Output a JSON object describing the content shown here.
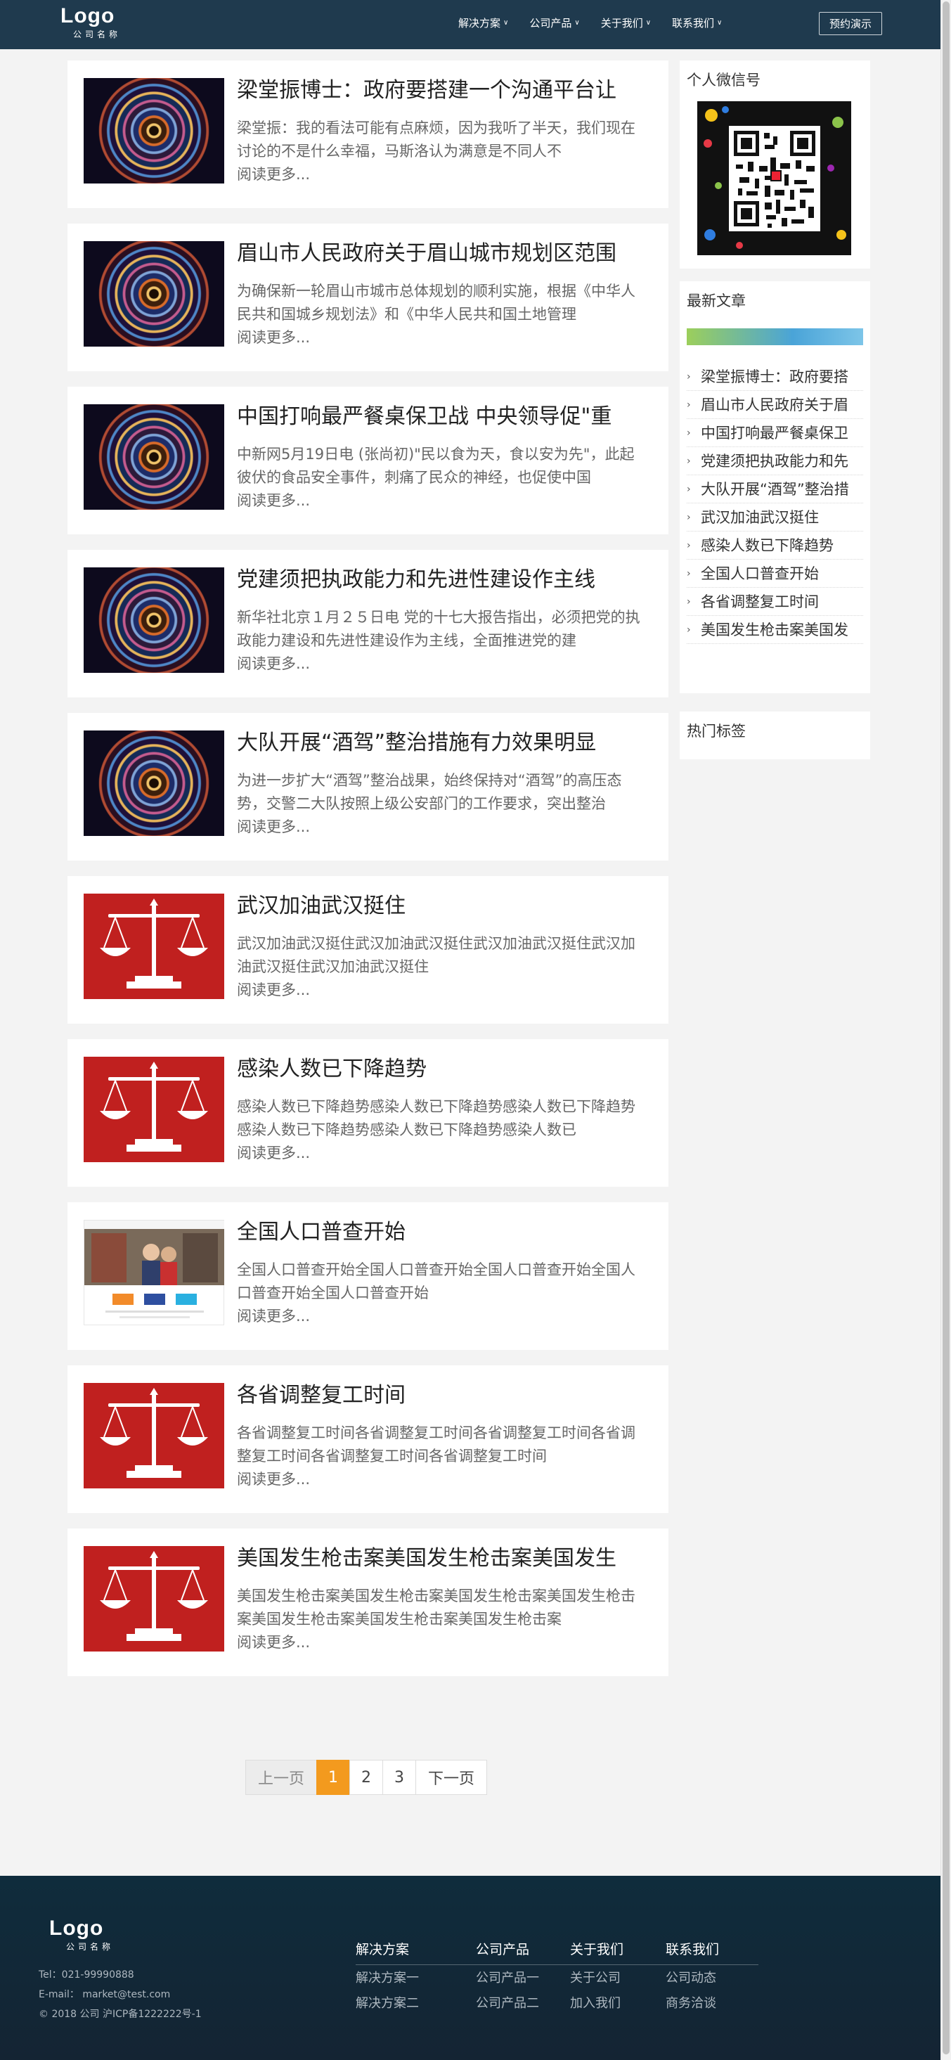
{
  "header": {
    "logo": "Logo",
    "logo_sub": "公司名称",
    "nav": [
      {
        "label": "解决方案"
      },
      {
        "label": "公司产品"
      },
      {
        "label": "关于我们"
      },
      {
        "label": "联系我们"
      }
    ],
    "demo_button": "预约演示"
  },
  "articles": [
    {
      "title": "梁堂振博士：政府要搭建一个沟通平台让",
      "excerpt": "梁堂振：我的看法可能有点麻烦，因为我听了半天，我们现在讨论的不是什么幸福，马斯洛认为满意是不同人不",
      "more": "阅读更多...",
      "image": "spiral-glass-ceiling"
    },
    {
      "title": "眉山市人民政府关于眉山城市规划区范围",
      "excerpt": "为确保新一轮眉山市城市总体规划的顺利实施，根据《中华人民共和国城乡规划法》和《中华人民共和国土地管理",
      "more": "阅读更多...",
      "image": "spiral-glass-ceiling"
    },
    {
      "title": "中国打响最严餐桌保卫战 中央领导促\"重",
      "excerpt": "中新网5月19日电 (张尚初)\"民以食为天，食以安为先\"，此起彼伏的食品安全事件，刺痛了民众的神经，也促使中国",
      "more": "阅读更多...",
      "image": "spiral-glass-ceiling"
    },
    {
      "title": "党建须把执政能力和先进性建设作主线",
      "excerpt": "新华社北京１月２５日电 党的十七大报告指出，必须把党的执政能力建设和先进性建设作为主线，全面推进党的建",
      "more": "阅读更多...",
      "image": "spiral-glass-ceiling"
    },
    {
      "title": "大队开展“酒驾”整治措施有力效果明显",
      "excerpt": "为进一步扩大“酒驾”整治战果，始终保持对“酒驾”的高压态势，交警二大队按照上级公安部门的工作要求，突出整治",
      "more": "阅读更多...",
      "image": "spiral-glass-ceiling"
    },
    {
      "title": "武汉加油武汉挺住",
      "excerpt": "武汉加油武汉挺住武汉加油武汉挺住武汉加油武汉挺住武汉加油武汉挺住武汉加油武汉挺住",
      "more": "阅读更多...",
      "image": "justice-scale"
    },
    {
      "title": "感染人数已下降趋势",
      "excerpt": "感染人数已下降趋势感染人数已下降趋势感染人数已下降趋势感染人数已下降趋势感染人数已下降趋势感染人数已",
      "more": "阅读更多...",
      "image": "justice-scale"
    },
    {
      "title": "全国人口普查开始",
      "excerpt": "全国人口普查开始全国人口普查开始全国人口普查开始全国人口普查开始全国人口普查开始",
      "more": "阅读更多...",
      "image": "website-screenshot"
    },
    {
      "title": "各省调整复工时间",
      "excerpt": "各省调整复工时间各省调整复工时间各省调整复工时间各省调整复工时间各省调整复工时间各省调整复工时间",
      "more": "阅读更多...",
      "image": "justice-scale"
    },
    {
      "title": "美国发生枪击案美国发生枪击案美国发生",
      "excerpt": "美国发生枪击案美国发生枪击案美国发生枪击案美国发生枪击案美国发生枪击案美国发生枪击案美国发生枪击案",
      "more": "阅读更多...",
      "image": "justice-scale"
    }
  ],
  "sidebar": {
    "wechat_title": "个人微信号",
    "latest_title": "最新文章",
    "latest": [
      "梁堂振博士：政府要搭",
      "眉山市人民政府关于眉",
      "中国打响最严餐桌保卫",
      "党建须把执政能力和先",
      "大队开展“酒驾”整治措",
      "武汉加油武汉挺住",
      "感染人数已下降趋势",
      "全国人口普查开始",
      "各省调整复工时间",
      "美国发生枪击案美国发"
    ],
    "tags_title": "热门标签"
  },
  "pagination": {
    "prev": "上一页",
    "pages": [
      "1",
      "2",
      "3"
    ],
    "current": "1",
    "next": "下一页"
  },
  "footer": {
    "logo": "Logo",
    "logo_sub": "公司名称",
    "tel": "Tel：021-99990888",
    "email": "E-mail： market@test.com",
    "copyright": "© 2018 公司 沪ICP备1222222号-1",
    "columns": [
      {
        "head": "解决方案",
        "links": [
          "解决方案一",
          "解决方案二"
        ]
      },
      {
        "head": "公司产品",
        "links": [
          "公司产品一",
          "公司产品二"
        ]
      },
      {
        "head": "关于我们",
        "links": [
          "关于公司",
          "加入我们"
        ]
      },
      {
        "head": "联系我们",
        "links": [
          "公司动态",
          "商务洽谈"
        ]
      }
    ]
  },
  "colors": {
    "header_bg": "#1f3a4e",
    "accent": "#f39a1e",
    "footer_bg": "#0f2c3c",
    "scale_red": "#c0201f"
  }
}
